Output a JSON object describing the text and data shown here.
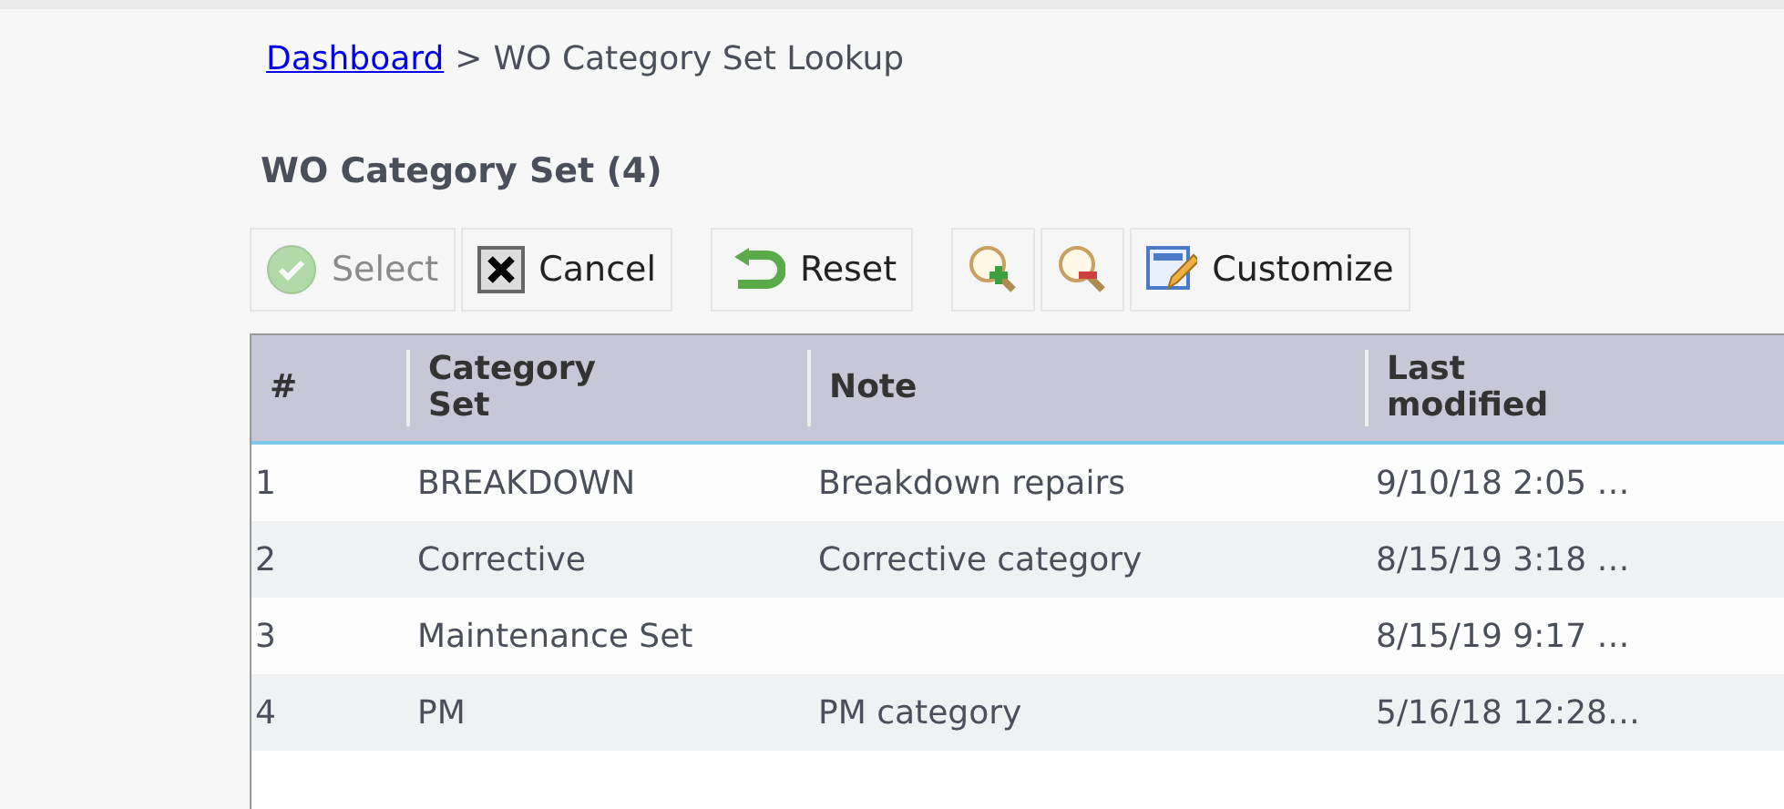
{
  "breadcrumb": {
    "link": "Dashboard",
    "separator": ">",
    "current": "WO Category Set Lookup"
  },
  "title": "WO Category Set (4)",
  "toolbar": [
    [
      {
        "kind": "select",
        "label": "Select",
        "disabled": true
      },
      {
        "kind": "cancel",
        "label": "Cancel",
        "disabled": false
      }
    ],
    [
      {
        "kind": "reset",
        "label": "Reset",
        "disabled": false
      }
    ],
    [
      {
        "kind": "zoom-in",
        "disabled": false
      },
      {
        "kind": "zoom-out",
        "disabled": false
      },
      {
        "kind": "customize",
        "label": "Customize",
        "disabled": false
      }
    ]
  ],
  "table": {
    "columns": [
      "#",
      "Category Set",
      "Note",
      "Last modified"
    ],
    "rows": [
      [
        "1",
        "BREAKDOWN",
        "Breakdown repairs",
        "9/10/18 2:05 …"
      ],
      [
        "2",
        "Corrective",
        "Corrective category",
        "8/15/19 3:18 …"
      ],
      [
        "3",
        "Maintenance Set",
        "",
        "8/15/19 9:17 …"
      ],
      [
        "4",
        "PM",
        "PM category",
        "5/16/18 12:28…"
      ]
    ]
  }
}
